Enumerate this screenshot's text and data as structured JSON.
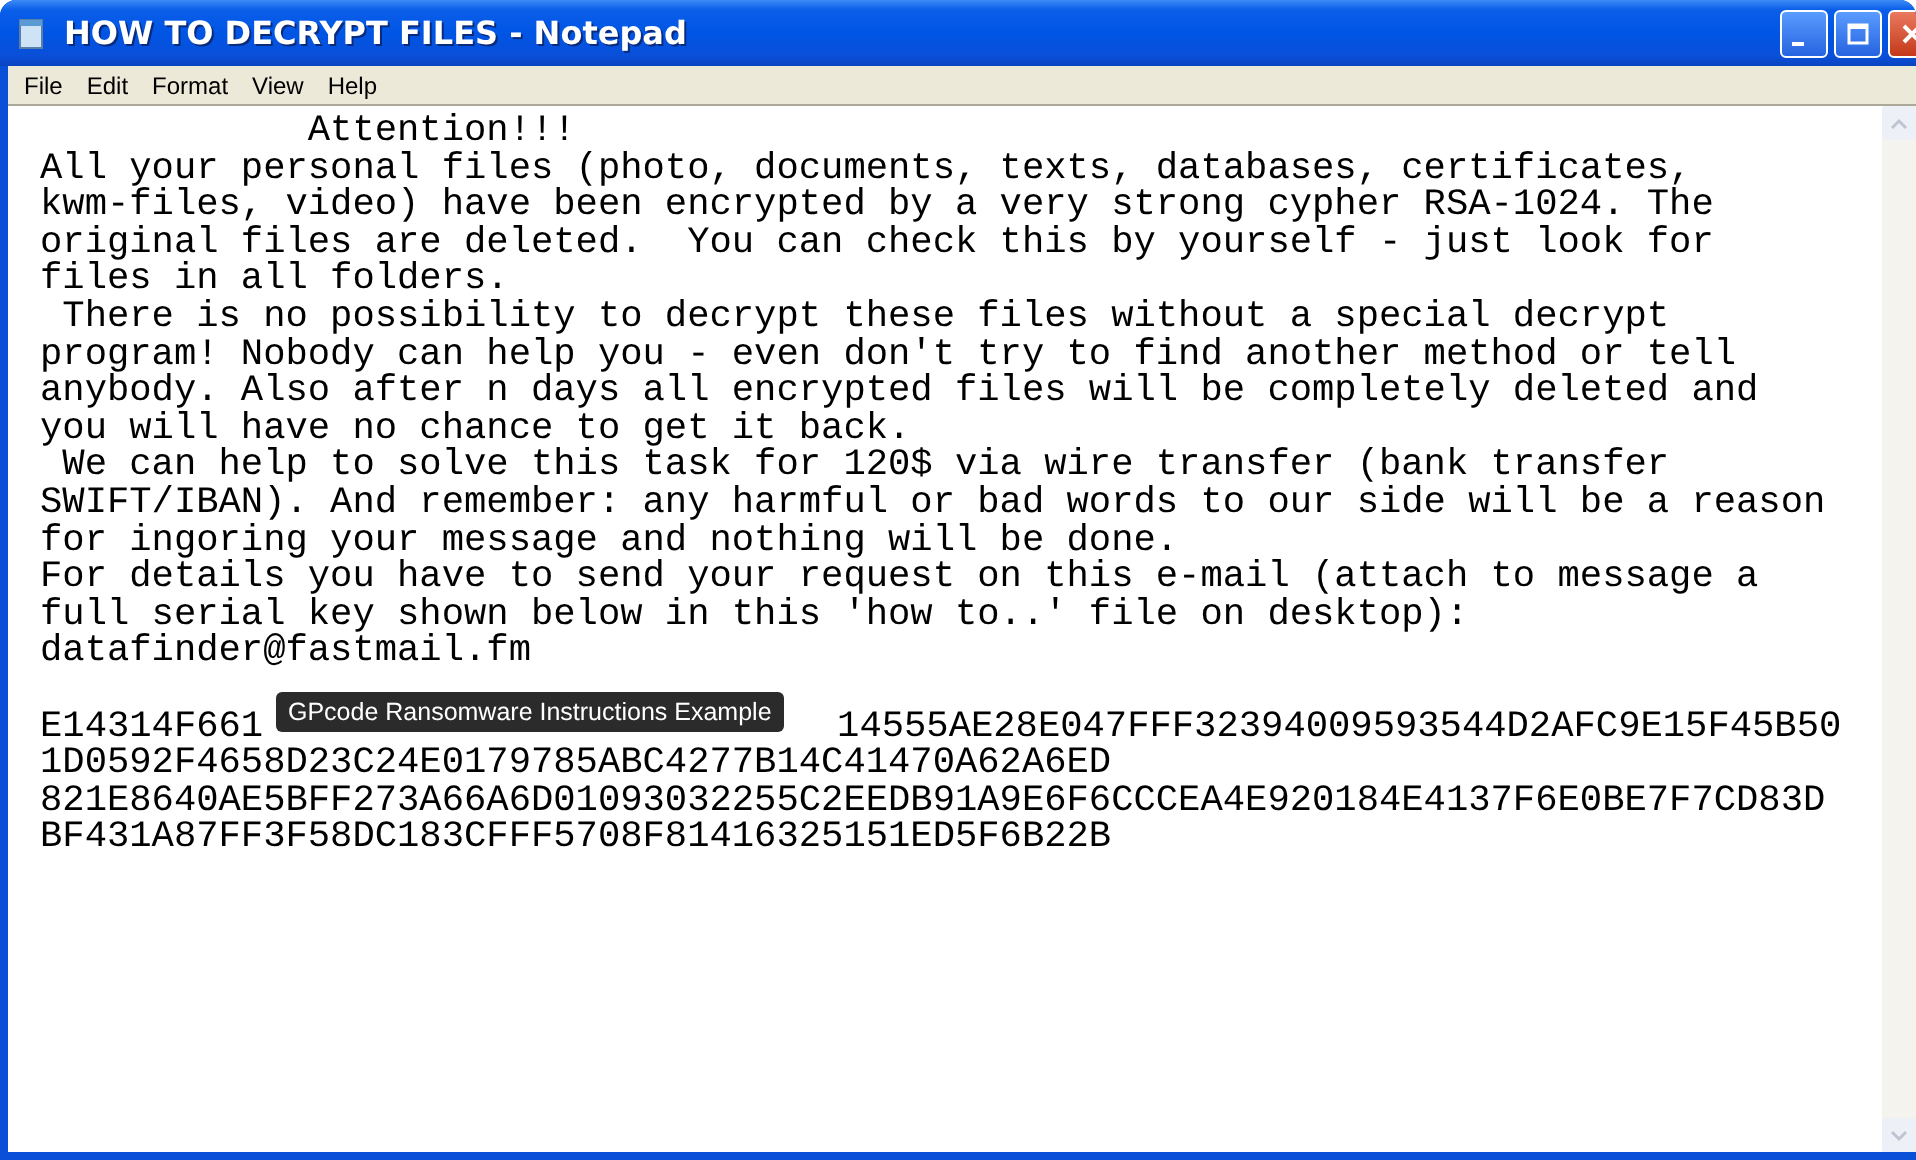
{
  "window": {
    "title": "HOW TO DECRYPT FILES - Notepad"
  },
  "menu": [
    "File",
    "Edit",
    "Format",
    "View",
    "Help"
  ],
  "document": {
    "lines": [
      "            Attention!!!",
      "All your personal files (photo, documents, texts, databases, certificates,",
      "kwm-files, video) have been encrypted by a very strong cypher RSA-1024. The",
      "original files are deleted.  You can check this by yourself - just look for",
      "files in all folders.",
      " There is no possibility to decrypt these files without a special decrypt",
      "program! Nobody can help you - even don't try to find another method or tell",
      "anybody. Also after n days all encrypted files will be completely deleted and",
      "you will have no chance to get it back.",
      " We can help to solve this task for 120$ via wire transfer (bank transfer",
      "SWIFT/IBAN). And remember: any harmful or bad words to our side will be a reason",
      "for ingoring your message and nothing will be done.",
      "For details you have to send your request on this e-mail (attach to message a",
      "full serial key shown below in this 'how to..' file on desktop):",
      "datafinder@fastmail.fm"
    ],
    "key_first_line": {
      "start": "E14314F661",
      "end": "14555AE28E047FFF32394009593544D2AFC9E15F45B50"
    },
    "key_lines": [
      "1D0592F4658D23C24E0179785ABC4277B14C41470A62A6ED",
      "821E8640AE5BFF273A66A6D01093032255C2EEDB91A9E6F6CCCEA4E920184E4137F6E0BE7F7CD83D",
      "BF431A87FF3F58DC183CFFF5708F81416325151ED5F6B22B"
    ]
  },
  "tooltip": {
    "text": "GPcode Ransomware Instructions Example"
  }
}
